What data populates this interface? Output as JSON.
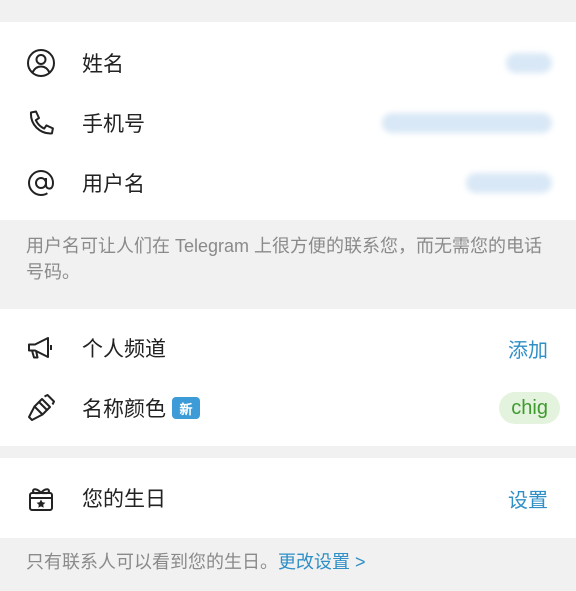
{
  "profile": {
    "name_label": "姓名",
    "phone_label": "手机号",
    "username_label": "用户名"
  },
  "username_hint": "用户名可让人们在 Telegram 上很方便的联系您，而无需您的电话号码。",
  "personal": {
    "channel_label": "个人频道",
    "channel_action": "添加",
    "name_color_label": "名称颜色",
    "new_badge": "新",
    "name_color_value": "chig"
  },
  "birthday": {
    "label": "您的生日",
    "action": "设置",
    "hint_text": "只有联系人可以看到您的生日。",
    "hint_link": "更改设置 >"
  },
  "colors": {
    "accent": "#2f8fc6",
    "chip_bg": "#e3f3dd",
    "chip_text": "#3f9a2f",
    "badge_bg": "#3d9bd8"
  },
  "icons": {
    "name": "user-circle-icon",
    "phone": "phone-icon",
    "username": "at-sign-icon",
    "channel": "megaphone-icon",
    "name_color": "brush-icon",
    "birthday": "gift-icon"
  }
}
